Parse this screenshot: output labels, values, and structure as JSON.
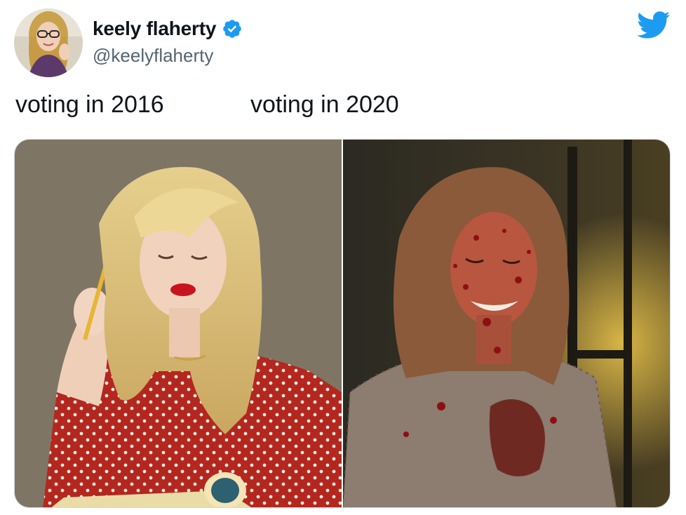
{
  "author": {
    "display_name": "keely flaherty",
    "handle": "@keelyflaherty",
    "verified": true,
    "avatar_icon": "avatar",
    "verified_icon": "verified-badge-icon"
  },
  "brand": {
    "icon": "twitter-bird-icon",
    "color": "#1d9bf0"
  },
  "tweet": {
    "caption_left": "voting in 2016",
    "caption_right": "voting in 2020"
  },
  "media": {
    "images": [
      {
        "name": "photo-2016"
      },
      {
        "name": "photo-2020"
      }
    ]
  }
}
